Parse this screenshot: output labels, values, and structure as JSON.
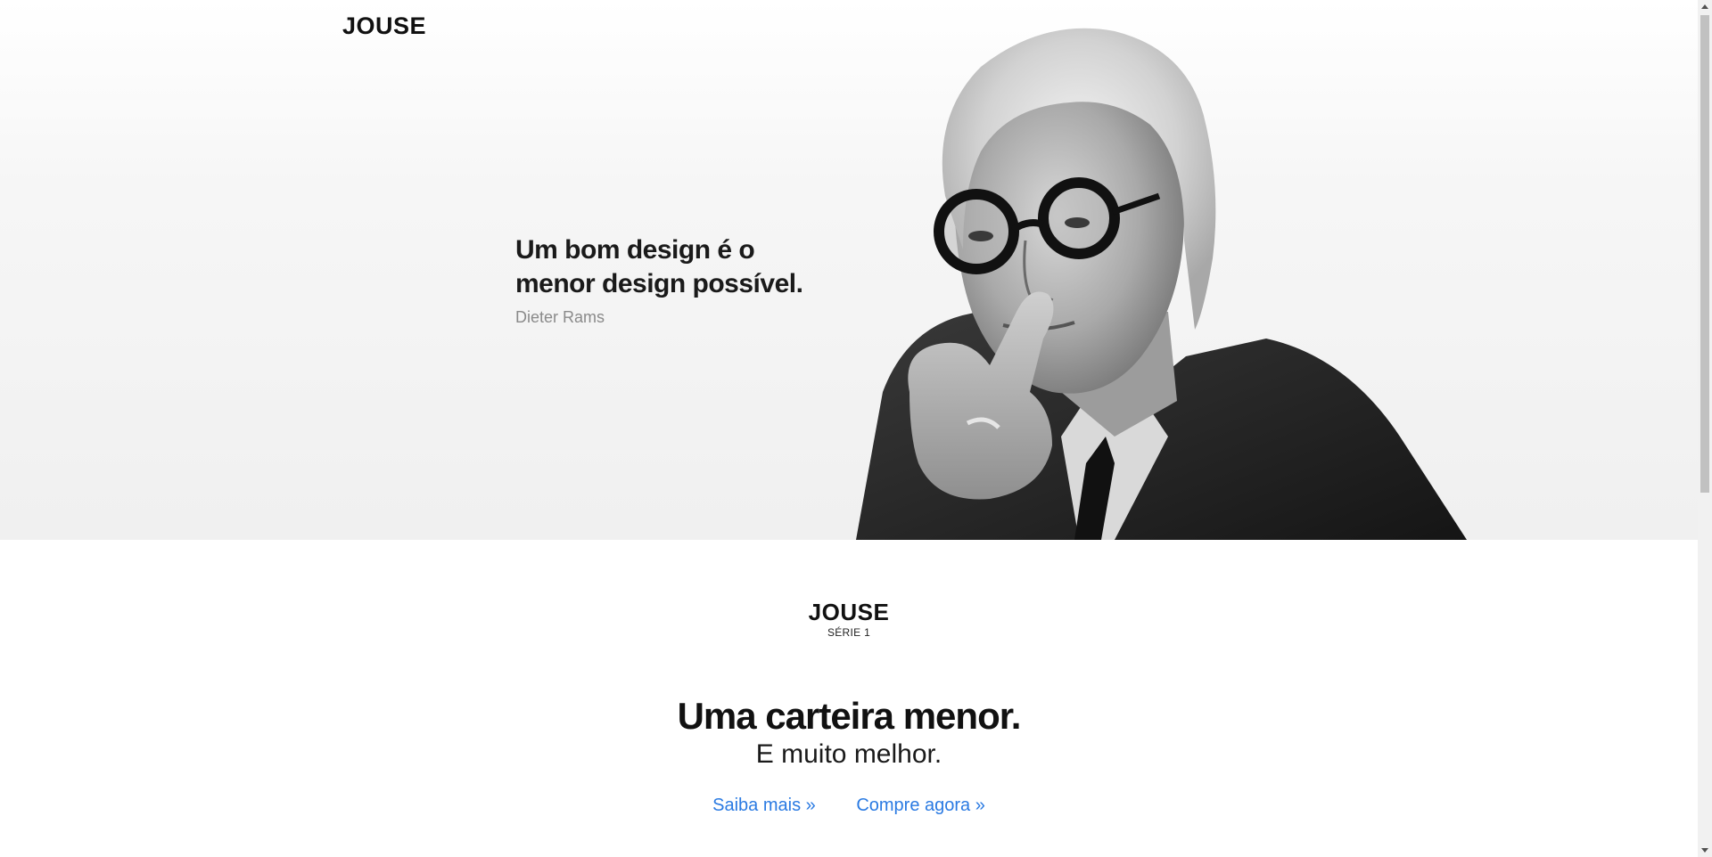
{
  "header": {
    "brand": "JOUSE"
  },
  "hero": {
    "quote": "Um bom design é o menor design possível.",
    "author": "Dieter Rams"
  },
  "product": {
    "logo": "JOUSE",
    "series": "SÉRIE 1",
    "headline": "Uma carteira menor.",
    "subheadline": "E muito melhor.",
    "links": {
      "learn_more": "Saiba mais »",
      "buy_now": "Compre agora »"
    }
  },
  "colors": {
    "link": "#2a7ae2",
    "text": "#111111",
    "muted": "#8a8a8a"
  }
}
